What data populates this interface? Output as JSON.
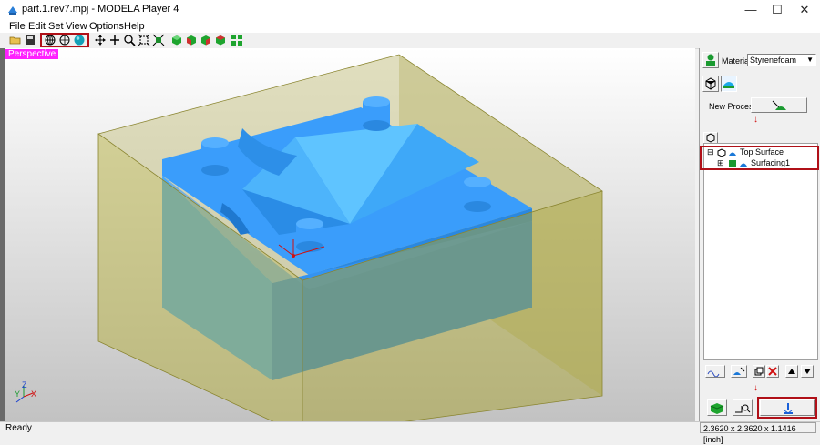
{
  "window": {
    "title": "part.1.rev7.mpj - MODELA Player 4",
    "minimize": "—",
    "maximize": "☐",
    "close": "✕"
  },
  "menu": [
    "File",
    "Edit",
    "Set",
    "View",
    "Options",
    "Help"
  ],
  "viewport": {
    "label": "Perspective",
    "axes": {
      "y": "Y",
      "z": "Z",
      "x": "X"
    }
  },
  "right_panel": {
    "material_label": "Material",
    "material_value": "Styrenefoam",
    "new_process_label": "New Process",
    "tree": {
      "root": "Top Surface",
      "child": "Surfacing1",
      "root_toggle": "⊟",
      "child_toggle": "⊞"
    },
    "down_arrow": "↓"
  },
  "status": {
    "left": "Ready",
    "right": "2.3620 x 2.3620 x 1.1416 [inch]"
  },
  "colors": {
    "highlight": "#b01018",
    "model": "#3a9dfb",
    "stock": "#b4ad3c"
  }
}
